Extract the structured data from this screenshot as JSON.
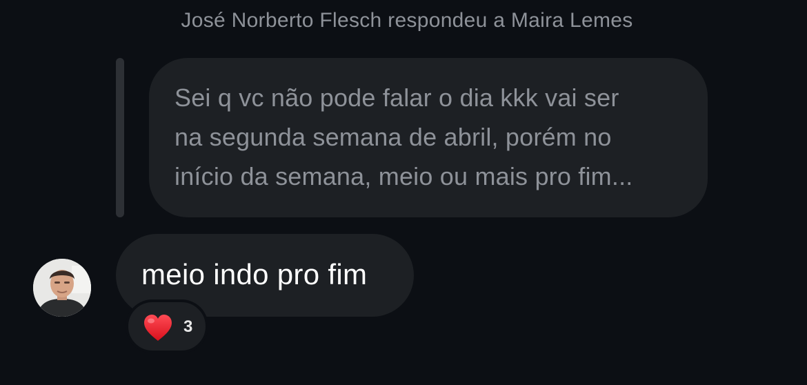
{
  "reply_header": "José Norberto Flesch respondeu a Maira Lemes",
  "quoted_message": {
    "lines": [
      "Sei q vc não pode falar o dia kkk vai ser",
      "na segunda semana de abril, porém no",
      "início da semana, meio ou mais pro fim..."
    ]
  },
  "message": {
    "text": "meio indo pro fim"
  },
  "reaction": {
    "icon": "heart-icon",
    "count": "3",
    "color": "#e8232f"
  },
  "avatar": {
    "icon": "profile-photo"
  },
  "colors": {
    "background": "#0c0f14",
    "bubble": "#1d2024",
    "muted_text": "#8e9299",
    "text": "#ffffff"
  }
}
